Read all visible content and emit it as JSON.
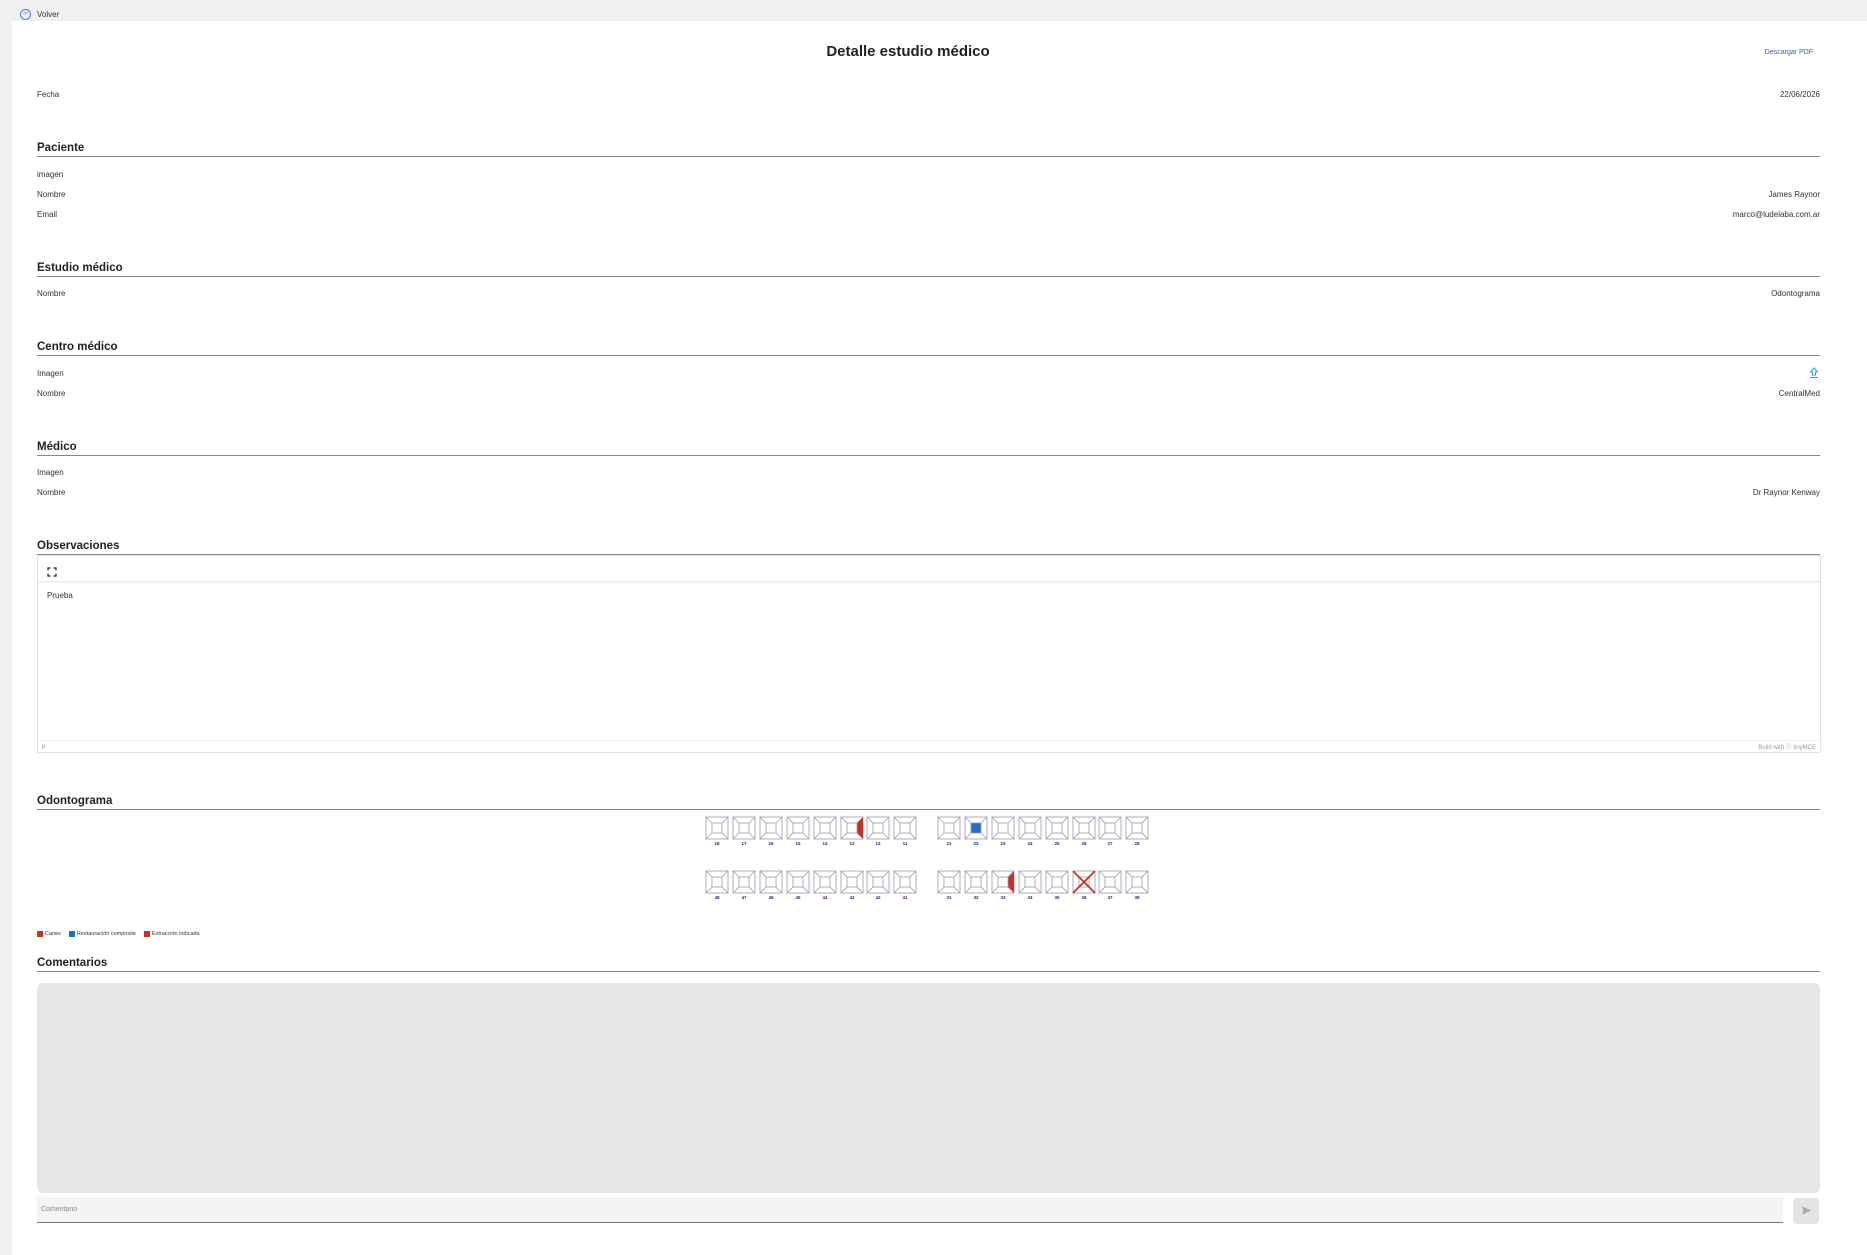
{
  "topbar": {
    "back_label": "Volver"
  },
  "header": {
    "title": "Detalle estudio médico",
    "pdf_label": "Descargar PDF"
  },
  "fecha": {
    "label": "Fecha",
    "value": "22/06/2026"
  },
  "paciente": {
    "title": "Paciente",
    "imagen_label": "imagen",
    "nombre_label": "Nombre",
    "nombre_value": "James Raynor",
    "email_label": "Email",
    "email_value": "marco@ludelaba.com.ar"
  },
  "estudio": {
    "title": "Estudio médico",
    "nombre_label": "Nombre",
    "nombre_value": "Odontograma"
  },
  "centro": {
    "title": "Centro médico",
    "imagen_label": "Imagen",
    "imagen_icon": "upload-icon",
    "nombre_label": "Nombre",
    "nombre_value": "CentralMed"
  },
  "medico": {
    "title": "Médico",
    "imagen_label": "Imagen",
    "nombre_label": "Nombre",
    "nombre_value": "Dr Raynor Kenway"
  },
  "observaciones": {
    "title": "Observaciones",
    "content": "Prueba",
    "status_path": "p",
    "brand": "Build with ⓣ tinyMCE",
    "toolbar_icon": "fullscreen-icon"
  },
  "odontograma": {
    "title": "Odontograma",
    "upper_right": [
      "18",
      "17",
      "16",
      "15",
      "14",
      "13",
      "12",
      "11"
    ],
    "upper_left": [
      "21",
      "22",
      "23",
      "24",
      "25",
      "26",
      "27",
      "28"
    ],
    "lower_right": [
      "48",
      "47",
      "46",
      "45",
      "44",
      "43",
      "42",
      "41"
    ],
    "lower_left": [
      "31",
      "32",
      "33",
      "34",
      "35",
      "36",
      "37",
      "38"
    ],
    "marks": [
      {
        "tooth": "13",
        "surface": "right",
        "condition": "caries"
      },
      {
        "tooth": "22",
        "surface": "center",
        "condition": "restauracion"
      },
      {
        "tooth": "33",
        "surface": "right",
        "condition": "caries"
      },
      {
        "tooth": "36",
        "surface": "whole",
        "condition": "extraccion"
      }
    ],
    "legend": [
      {
        "label": "Caries",
        "color": "#c9302c"
      },
      {
        "label": "Restauración composite",
        "color": "#1f6fd1"
      },
      {
        "label": "Extracción indicada",
        "color": "#c9302c"
      }
    ]
  },
  "comentarios": {
    "title": "Comentarios",
    "placeholder": "Comentario",
    "send_icon": "send-icon"
  },
  "colors": {
    "accent": "#3a5fad",
    "caries": "#c9302c",
    "restauracion": "#1f6fd1",
    "icon": "#29a3d6"
  }
}
